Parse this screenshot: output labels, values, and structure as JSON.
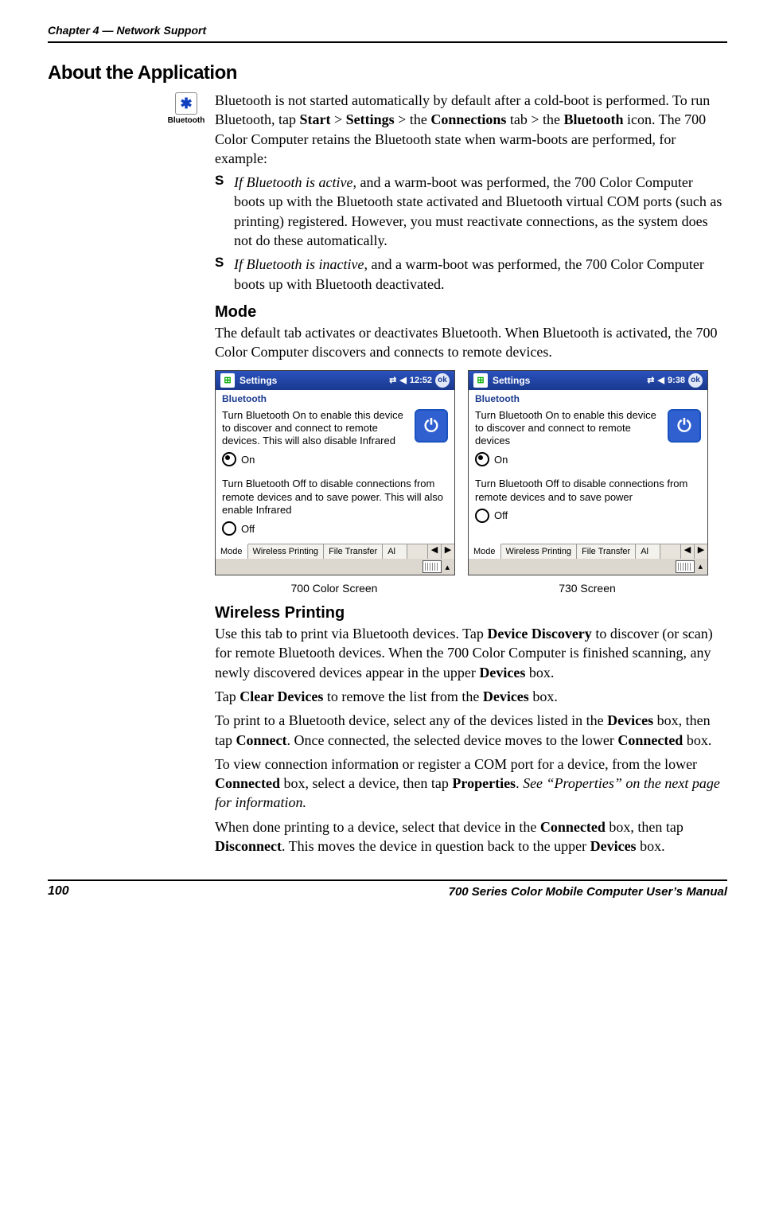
{
  "header": {
    "chapter_line": "Chapter 4  —  Network Support"
  },
  "section": {
    "title": "About the Application",
    "icon_label": "Bluetooth",
    "icon_glyph": "✱",
    "intro": {
      "p1_1": "Bluetooth is not started automatically by default after a cold-boot is performed. To run Bluetooth, tap ",
      "start": "Start",
      "gt1": " > ",
      "settings": "Settings",
      "gt2": " > the ",
      "connections": "Connections",
      "p1_2": " tab > the ",
      "bluetooth": "Bluetooth",
      "p1_3": " icon. The 700 Color Computer retains the Bluetooth state when warm-boots are performed, for example:"
    },
    "bullets": [
      {
        "lead_italic": "If Bluetooth is active",
        "rest": ", and a warm-boot was performed, the 700 Color Computer boots up with the Bluetooth state activated and Bluetooth virtual COM ports (such as printing) registered. However, you must reactivate connections, as the system does not do these automatically."
      },
      {
        "lead_italic": "If Bluetooth is inactive",
        "rest": ", and a warm-boot was performed, the 700 Color Computer boots up with Bluetooth deactivated."
      }
    ]
  },
  "mode": {
    "heading": "Mode",
    "body": "The default tab activates or deactivates Bluetooth. When Bluetooth is activated, the 700 Color Computer discovers and connects to remote devices."
  },
  "screenshots": {
    "left": {
      "titlebar": "Settings",
      "time": "12:52",
      "ok": "ok",
      "subtitle": "Bluetooth",
      "on_title": "Turn Bluetooth On to enable this device to discover and connect to remote devices. This will also disable Infrared",
      "on_label": "On",
      "off_title": "Turn Bluetooth Off to disable connections from remote devices and to save power. This will also enable Infrared",
      "off_label": "Off",
      "tabs": [
        "Mode",
        "Wireless Printing",
        "File Transfer",
        "Al"
      ],
      "caption": "700 Color Screen"
    },
    "right": {
      "titlebar": "Settings",
      "time": "9:38",
      "ok": "ok",
      "subtitle": "Bluetooth",
      "on_title": "Turn Bluetooth On to enable this device to discover and connect to remote devices",
      "on_label": "On",
      "off_title": "Turn Bluetooth Off to disable connections from remote devices and to save power",
      "off_label": "Off",
      "tabs": [
        "Mode",
        "Wireless Printing",
        "File Transfer",
        "Al"
      ],
      "caption": "730 Screen"
    }
  },
  "wireless": {
    "heading": "Wireless Printing",
    "p1_1": "Use this tab to print via Bluetooth devices. Tap ",
    "p1_b1": "Device Discovery",
    "p1_2": " to discover (or scan) for remote Bluetooth devices. When the 700 Color Computer is finished scanning, any newly discovered devices appear in the upper ",
    "p1_b2": "Devices",
    "p1_3": " box.",
    "p2_1": "Tap ",
    "p2_b1": "Clear Devices",
    "p2_2": " to remove the list from the ",
    "p2_b2": "Devices",
    "p2_3": " box.",
    "p3_1": "To print to a Bluetooth device, select any of the devices listed in the ",
    "p3_b1": "Devices",
    "p3_2": " box, then tap ",
    "p3_b2": "Connect",
    "p3_3": ". Once connected, the selected device moves to the lower ",
    "p3_b3": "Connected",
    "p3_4": " box.",
    "p4_1": "To view connection information or register a COM port for a device, from the lower ",
    "p4_b1": "Connected",
    "p4_2": " box, select a device, then tap ",
    "p4_b2": "Properties",
    "p4_3": ". ",
    "p4_i": "See “Properties” on the next page for information.",
    "p5_1": "When done printing to a device, select that device in the ",
    "p5_b1": "Connected",
    "p5_2": " box, then tap ",
    "p5_b2": "Disconnect",
    "p5_3": ". This moves the device in question back to the upper ",
    "p5_b3": "Devices",
    "p5_4": " box."
  },
  "footer": {
    "page": "100",
    "title": "700 Series Color Mobile Computer User’s Manual"
  },
  "symbols": {
    "bullet": "S",
    "speaker": "◀",
    "signal": "📶",
    "left": "◀",
    "right": "▶",
    "up": "▴"
  }
}
